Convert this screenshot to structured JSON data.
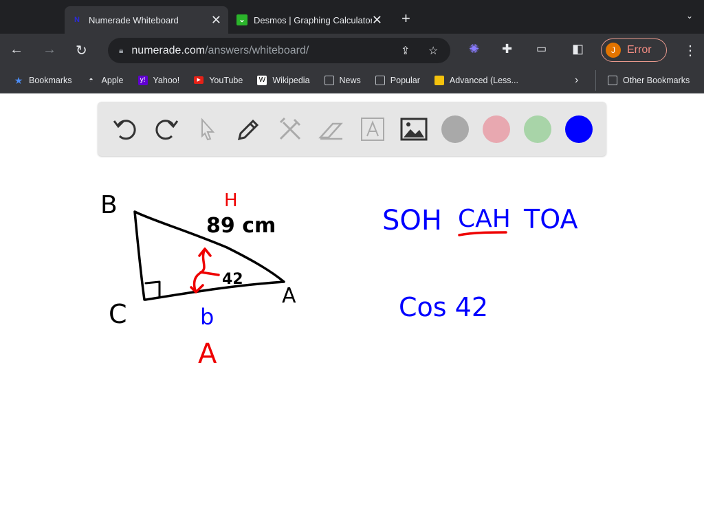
{
  "tabs": [
    {
      "title": "Numerade Whiteboard",
      "active": true,
      "icon": "numerade-icon"
    },
    {
      "title": "Desmos | Graphing Calculator",
      "active": false,
      "icon": "desmos-icon"
    }
  ],
  "nav": {
    "url_host": "numerade.com",
    "url_path": "/answers/whiteboard/",
    "profile_initial": "J",
    "profile_status": "Error"
  },
  "bookmarks": [
    {
      "label": "Bookmarks",
      "icon": "star-icon"
    },
    {
      "label": "Apple",
      "icon": "apple-icon"
    },
    {
      "label": "Yahoo!",
      "icon": "yahoo-icon"
    },
    {
      "label": "YouTube",
      "icon": "youtube-icon"
    },
    {
      "label": "Wikipedia",
      "icon": "wikipedia-icon"
    },
    {
      "label": "News",
      "icon": "folder-icon"
    },
    {
      "label": "Popular",
      "icon": "folder-icon"
    },
    {
      "label": "Advanced (Less...",
      "icon": "bookmark-icon"
    }
  ],
  "other_bookmarks": "Other Bookmarks",
  "whiteboard": {
    "tools": [
      "undo",
      "redo",
      "select",
      "pen",
      "tools",
      "eraser",
      "text",
      "image"
    ],
    "colors": [
      "#a9a9a9",
      "#e8a8b0",
      "#a8d4a8",
      "#0000ff"
    ],
    "selected_color": "#0000ff",
    "drawing": {
      "vertex_b": "B",
      "vertex_c": "C",
      "vertex_a": "A",
      "hyp_label": "H",
      "hyp_length": "89 cm",
      "angle": "42",
      "side_b": "b",
      "adj_label": "A",
      "mnemonic": [
        "SOH",
        "CAH",
        "TOA"
      ],
      "equation": "Cos 42"
    }
  }
}
